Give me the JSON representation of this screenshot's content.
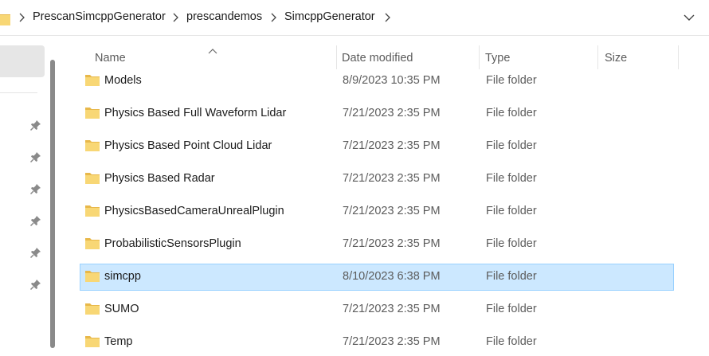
{
  "address_bar": {
    "breadcrumbs": [
      "PrescanSimcppGenerator",
      "prescandemos",
      "SimcppGenerator"
    ],
    "icons": {
      "folder": "folder-icon",
      "separator": "chevron-right-icon",
      "dropdown": "chevron-down-icon"
    }
  },
  "navigation_pane": {
    "icons": {
      "pin": "pin-icon"
    },
    "pinned_count": 6
  },
  "columns": {
    "name": "Name",
    "date_modified": "Date modified",
    "type": "Type",
    "size": "Size",
    "sorted_by": "Name"
  },
  "rows": [
    {
      "name": "Models",
      "date": "8/9/2023 10:35 PM",
      "type": "File folder",
      "selected": false
    },
    {
      "name": "Physics Based Full Waveform Lidar",
      "date": "7/21/2023 2:35 PM",
      "type": "File folder",
      "selected": false
    },
    {
      "name": "Physics Based Point Cloud Lidar",
      "date": "7/21/2023 2:35 PM",
      "type": "File folder",
      "selected": false
    },
    {
      "name": "Physics Based Radar",
      "date": "7/21/2023 2:35 PM",
      "type": "File folder",
      "selected": false
    },
    {
      "name": "PhysicsBasedCameraUnrealPlugin",
      "date": "7/21/2023 2:35 PM",
      "type": "File folder",
      "selected": false
    },
    {
      "name": "ProbabilisticSensorsPlugin",
      "date": "7/21/2023 2:35 PM",
      "type": "File folder",
      "selected": false
    },
    {
      "name": "simcpp",
      "date": "8/10/2023 6:38 PM",
      "type": "File folder",
      "selected": true
    },
    {
      "name": "SUMO",
      "date": "7/21/2023 2:35 PM",
      "type": "File folder",
      "selected": false
    },
    {
      "name": "Temp",
      "date": "7/21/2023 2:35 PM",
      "type": "File folder",
      "selected": false
    }
  ],
  "colors": {
    "selection_fill": "#cce8ff",
    "selection_border": "#99d1ff",
    "folder_yellow": "#f8d775",
    "folder_dark": "#e8b84a"
  }
}
